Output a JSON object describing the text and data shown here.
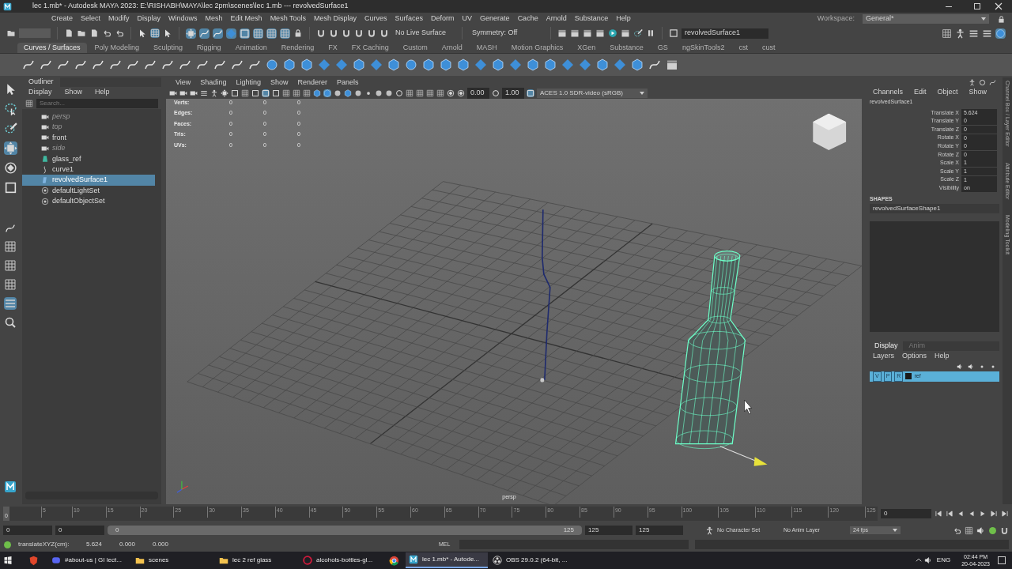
{
  "window": {
    "title": "lec 1.mb* - Autodesk MAYA 2023: E:\\RISHABH\\MAYA\\lec 2pm\\scenes\\lec 1.mb  ---  revolvedSurface1"
  },
  "menu": [
    "Create",
    "Select",
    "Modify",
    "Display",
    "Windows",
    "Mesh",
    "Edit Mesh",
    "Mesh Tools",
    "Mesh Display",
    "Curves",
    "Surfaces",
    "Deform",
    "UV",
    "Generate",
    "Cache",
    "Arnold",
    "Substance",
    "Help"
  ],
  "workspace": {
    "label": "Workspace:",
    "value": "General*"
  },
  "status_line": {
    "live_surface": "No Live Surface",
    "symmetry": "Symmetry: Off",
    "name_field": "revolvedSurface1"
  },
  "shelf_tabs": [
    {
      "label": "Curves / Surfaces",
      "selected": true
    },
    {
      "label": "Poly Modeling",
      "selected": false
    },
    {
      "label": "Sculpting",
      "selected": false
    },
    {
      "label": "Rigging",
      "selected": false
    },
    {
      "label": "Animation",
      "selected": false
    },
    {
      "label": "Rendering",
      "selected": false
    },
    {
      "label": "FX",
      "selected": false
    },
    {
      "label": "FX Caching",
      "selected": false
    },
    {
      "label": "Custom",
      "selected": false
    },
    {
      "label": "Arnold",
      "selected": false
    },
    {
      "label": "MASH",
      "selected": false
    },
    {
      "label": "Motion Graphics",
      "selected": false
    },
    {
      "label": "XGen",
      "selected": false
    },
    {
      "label": "Substance",
      "selected": false
    },
    {
      "label": "GS",
      "selected": false
    },
    {
      "label": "ngSkinTools2",
      "selected": false
    },
    {
      "label": "cst",
      "selected": false
    },
    {
      "label": "cust",
      "selected": false
    }
  ],
  "outliner": {
    "title": "Outliner",
    "menu": [
      "Display",
      "Show",
      "Help"
    ],
    "search_placeholder": "Search...",
    "items": [
      {
        "label": "persp",
        "kind": "camera",
        "dimmed": true,
        "selected": false
      },
      {
        "label": "top",
        "kind": "camera",
        "dimmed": true,
        "selected": false
      },
      {
        "label": "front",
        "kind": "camera",
        "dimmed": false,
        "selected": false
      },
      {
        "label": "side",
        "kind": "camera",
        "dimmed": true,
        "selected": false
      },
      {
        "label": "glass_ref",
        "kind": "mesh",
        "dimmed": false,
        "selected": false
      },
      {
        "label": "curve1",
        "kind": "curve",
        "dimmed": false,
        "selected": false
      },
      {
        "label": "revolvedSurface1",
        "kind": "surface",
        "dimmed": false,
        "selected": true
      },
      {
        "label": "defaultLightSet",
        "kind": "set",
        "dimmed": false,
        "selected": false
      },
      {
        "label": "defaultObjectSet",
        "kind": "set",
        "dimmed": false,
        "selected": false
      }
    ]
  },
  "viewport": {
    "menu": [
      "View",
      "Shading",
      "Lighting",
      "Show",
      "Renderer",
      "Panels"
    ],
    "exposure": "0.00",
    "gamma": "1.00",
    "color_space": "ACES 1.0 SDR-video (sRGB)",
    "hud": [
      {
        "label": "Verts:",
        "values": [
          "0",
          "0",
          "0"
        ]
      },
      {
        "label": "Edges:",
        "values": [
          "0",
          "0",
          "0"
        ]
      },
      {
        "label": "Faces:",
        "values": [
          "0",
          "0",
          "0"
        ]
      },
      {
        "label": "Tris:",
        "values": [
          "0",
          "0",
          "0"
        ]
      },
      {
        "label": "UVs:",
        "values": [
          "0",
          "0",
          "0"
        ]
      }
    ],
    "camera_label": "persp"
  },
  "channel_box": {
    "menu": [
      "Channels",
      "Edit",
      "Object",
      "Show"
    ],
    "object": "revolvedSurface1",
    "attributes": [
      {
        "name": "Translate X",
        "value": "5.624"
      },
      {
        "name": "Translate Y",
        "value": "0"
      },
      {
        "name": "Translate Z",
        "value": "0"
      },
      {
        "name": "Rotate X",
        "value": "0"
      },
      {
        "name": "Rotate Y",
        "value": "0"
      },
      {
        "name": "Rotate Z",
        "value": "0"
      },
      {
        "name": "Scale X",
        "value": "1"
      },
      {
        "name": "Scale Y",
        "value": "1"
      },
      {
        "name": "Scale Z",
        "value": "1"
      },
      {
        "name": "Visibility",
        "value": "on"
      }
    ],
    "shapes_heading": "SHAPES",
    "shape": "revolvedSurfaceShape1"
  },
  "layer_editor": {
    "tabs": [
      {
        "label": "Display",
        "selected": true
      },
      {
        "label": "Anim",
        "selected": false
      }
    ],
    "menu": [
      "Layers",
      "Options",
      "Help"
    ],
    "layers": [
      {
        "name": "ref",
        "toggles": [
          "V",
          "P",
          "R"
        ],
        "selected": true
      }
    ]
  },
  "side_tabs": [
    "Channel Box / Layer Editor",
    "Attribute Editor",
    "Modeling Toolkit"
  ],
  "timeline": {
    "current": "0",
    "level": 0,
    "ticks": [
      "5",
      "10",
      "15",
      "20",
      "25",
      "30",
      "35",
      "40",
      "45",
      "50",
      "55",
      "60",
      "65",
      "70",
      "75",
      "80",
      "85",
      "90",
      "95",
      "100",
      "105",
      "110",
      "115",
      "120",
      "125"
    ],
    "frame_field": "0"
  },
  "range": {
    "level": 1,
    "start": "0",
    "inner_start": "0",
    "slider_start": "0",
    "slider_end": "125",
    "inner_end": "125",
    "end": "125",
    "character_set": "No Character Set",
    "anim_layer": "No Anim Layer",
    "fps": "24 fps"
  },
  "command_line": {
    "feedback": "translateXYZ(cm):",
    "values": [
      "5.624",
      "0.000",
      "0.000"
    ],
    "language": "MEL"
  },
  "taskbar": {
    "items": [
      {
        "label": "#about-us | GI lect...",
        "kind": "chat",
        "selected": false
      },
      {
        "label": "scenes",
        "kind": "folder",
        "selected": false
      },
      {
        "label": "lec 2 ref glass",
        "kind": "folder",
        "selected": false
      },
      {
        "label": "alcohols-bottles-gl...",
        "kind": "browser",
        "selected": false
      },
      {
        "label": "lec 1.mb* - Autode...",
        "kind": "maya",
        "selected": true
      },
      {
        "label": "OBS 29.0.2 (64-bit, ...",
        "kind": "obs",
        "selected": false
      }
    ],
    "language": "ENG",
    "time": "02:44 PM",
    "date": "20-04-2023"
  }
}
